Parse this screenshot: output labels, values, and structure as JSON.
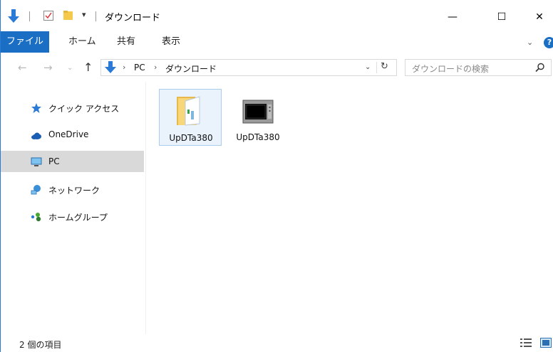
{
  "window": {
    "title": "ダウンロード",
    "controls": {
      "minimize": "—",
      "maximize": "☐",
      "close": "✕"
    }
  },
  "quick_access": {
    "dropdown": "▾",
    "separator": "|"
  },
  "ribbon": {
    "tabs": [
      "ファイル",
      "ホーム",
      "共有",
      "表示"
    ],
    "expand": "⌄",
    "help": "?"
  },
  "address": {
    "back": "←",
    "forward": "→",
    "history": "⌄",
    "up": "↑",
    "crumbs": [
      "PC",
      "ダウンロード"
    ],
    "crumb_sep": "›",
    "dropdown": "⌄",
    "refresh": "↻"
  },
  "search": {
    "placeholder": "ダウンロードの検索"
  },
  "nav": {
    "items": [
      {
        "label": "クイック アクセス",
        "icon": "star-icon"
      },
      {
        "label": "OneDrive",
        "icon": "cloud-icon"
      },
      {
        "label": "PC",
        "icon": "monitor-icon",
        "selected": true
      },
      {
        "label": "ネットワーク",
        "icon": "network-icon"
      },
      {
        "label": "ホームグループ",
        "icon": "homegroup-icon"
      }
    ]
  },
  "files": [
    {
      "name": "UpDTa380",
      "icon": "folder-icon",
      "selected": true
    },
    {
      "name": "UpDTa380",
      "icon": "microwave-icon",
      "selected": false
    }
  ],
  "status": {
    "count_text": "2 個の項目"
  },
  "colors": {
    "accent": "#1a6fc5",
    "selection": "#d9d9d9",
    "file_selection": "#eaf3fc"
  }
}
